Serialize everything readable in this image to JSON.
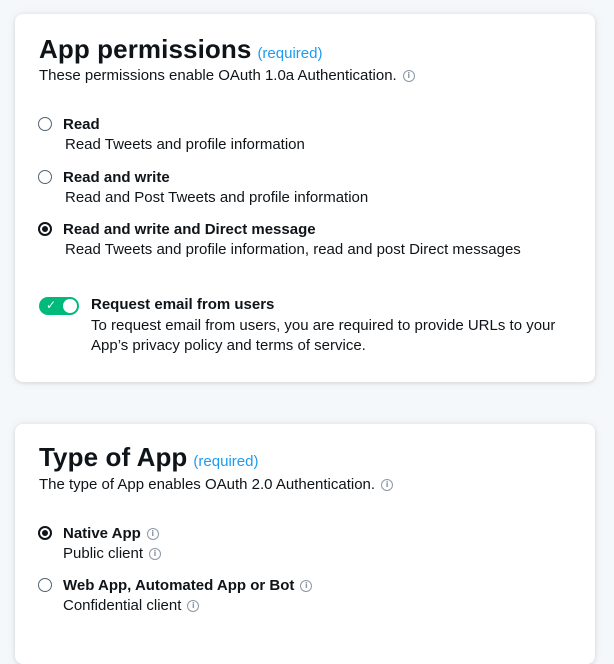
{
  "permissions": {
    "title": "App permissions",
    "required": "(required)",
    "subtitle": "These permissions enable OAuth 1.0a Authentication.",
    "options": [
      {
        "label": "Read",
        "desc": "Read Tweets and profile information",
        "selected": false
      },
      {
        "label": "Read and write",
        "desc": "Read and Post Tweets and profile information",
        "selected": false
      },
      {
        "label": "Read and write and Direct message",
        "desc": "Read Tweets and profile information, read and post Direct messages",
        "selected": true
      }
    ],
    "email": {
      "label": "Request email from users",
      "desc": "To request email from users, you are required to provide URLs to your App’s privacy policy and terms of service.",
      "enabled": true
    }
  },
  "app_type": {
    "title": "Type of App",
    "required": "(required)",
    "subtitle": "The type of App enables OAuth 2.0 Authentication.",
    "options": [
      {
        "label": "Native App",
        "desc": "Public client",
        "selected": true
      },
      {
        "label": "Web App, Automated App or Bot",
        "desc": "Confidential client",
        "selected": false
      }
    ]
  },
  "icons": {
    "info": "info-icon",
    "check": "check-icon"
  },
  "colors": {
    "accent": "#1d9bf0",
    "toggle_on": "#00ba7c"
  }
}
